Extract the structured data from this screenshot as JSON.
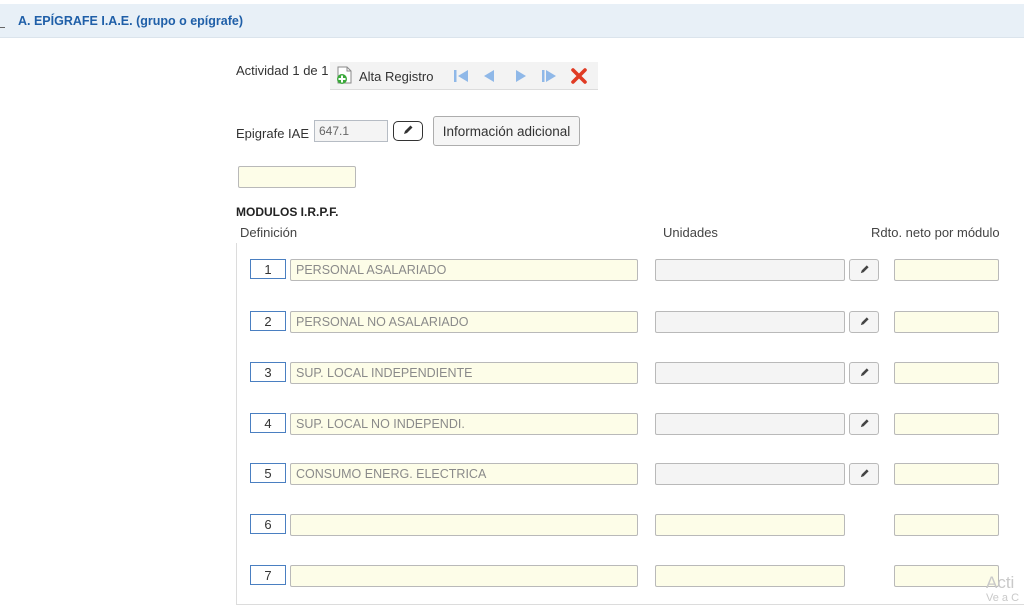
{
  "section": {
    "title": "A. EPÍGRAFE I.A.E. (grupo o epígrafe)"
  },
  "toolbar": {
    "activity_label": "Actividad 1 de 1",
    "alta_label": "Alta Registro",
    "icons": [
      "add-record-icon",
      "first-record-icon",
      "previous-record-icon",
      "next-record-icon",
      "last-record-icon",
      "delete-icon"
    ]
  },
  "epigrafe": {
    "label": "Epigrafe IAE",
    "value": "647.1",
    "info_button": "Información adicional"
  },
  "modulos": {
    "title": "MODULOS I.R.P.F.",
    "columns": {
      "definicion": "Definición",
      "unidades": "Unidades",
      "rdto": "Rdto. neto por módulo"
    },
    "rows": [
      {
        "num": "1",
        "definicion": "PERSONAL ASALARIADO"
      },
      {
        "num": "2",
        "definicion": "PERSONAL NO ASALARIADO"
      },
      {
        "num": "3",
        "definicion": "SUP. LOCAL INDEPENDIENTE"
      },
      {
        "num": "4",
        "definicion": "SUP. LOCAL NO INDEPENDI."
      },
      {
        "num": "5",
        "definicion": "CONSUMO ENERG. ELECTRICA"
      },
      {
        "num": "6",
        "definicion": ""
      },
      {
        "num": "7",
        "definicion": ""
      }
    ]
  },
  "watermark": {
    "line1": "Acti",
    "line2": "Ve a C"
  },
  "colors": {
    "header_bg": "#e8f0f7",
    "title_blue": "#1f5fa8",
    "field_yellow": "#fdfde8",
    "nav_blue": "#8fb8e8",
    "delete_red": "#e03b24"
  }
}
